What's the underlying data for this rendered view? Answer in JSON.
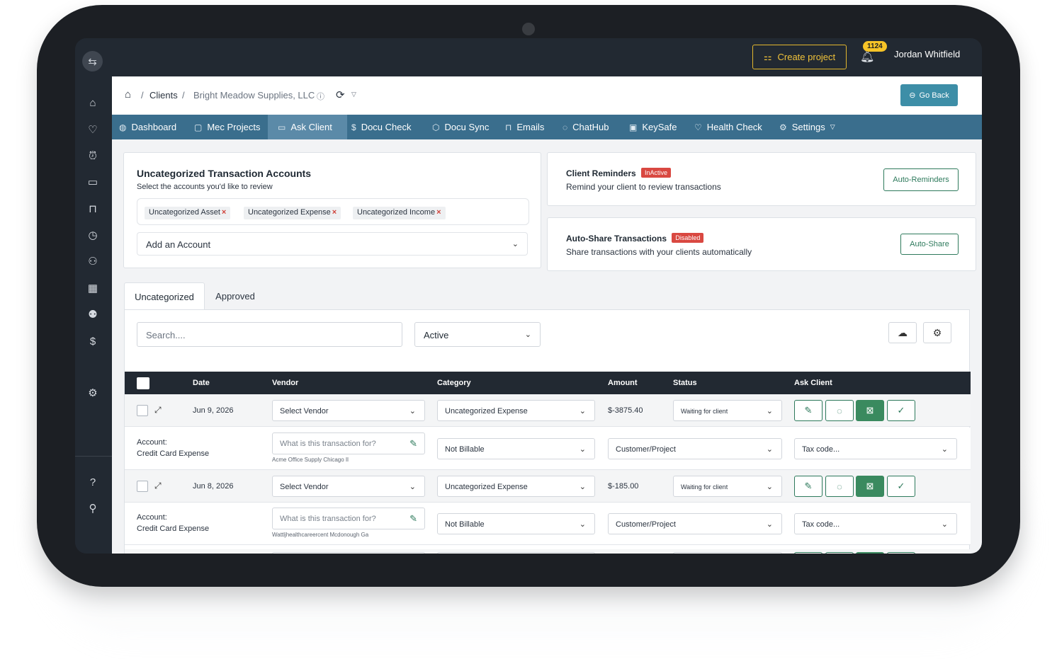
{
  "topbar": {
    "create_project": "Create project",
    "notifications": "1124",
    "user_name": "Jordan Whitfield"
  },
  "sidebar": {
    "icons": [
      "home-icon",
      "heart-icon",
      "alarm-icon",
      "briefcase-icon",
      "book-icon",
      "clock-icon",
      "users-icon",
      "calendar-icon",
      "team-icon",
      "dollar-icon",
      "gear-icon",
      "help-icon",
      "user-icon"
    ]
  },
  "breadcrumb": {
    "clients": "Clients",
    "client_name": "Bright Meadow Supplies, LLC",
    "go_back": "Go Back"
  },
  "nav": {
    "items": [
      {
        "label": "Dashboard",
        "icon": "palette-icon"
      },
      {
        "label": "Mec Projects",
        "icon": "folder-icon"
      },
      {
        "label": "Ask Client",
        "icon": "card-icon"
      },
      {
        "label": "Docu Check",
        "icon": "dollar-icon"
      },
      {
        "label": "Docu Sync",
        "icon": "box-icon"
      },
      {
        "label": "Emails",
        "icon": "book-icon"
      },
      {
        "label": "ChatHub",
        "icon": "chat-icon"
      },
      {
        "label": "KeySafe",
        "icon": "safe-icon"
      },
      {
        "label": "Health Check",
        "icon": "heart-icon"
      },
      {
        "label": "Settings",
        "icon": "gear-icon"
      }
    ],
    "active": "Ask Client"
  },
  "accounts_card": {
    "title": "Uncategorized Transaction Accounts",
    "subtitle": "Select the accounts you'd like to review",
    "chips": [
      "Uncategorized Asset",
      "Uncategorized Expense",
      "Uncategorized Income"
    ],
    "add_account": "Add an Account"
  },
  "reminders_card": {
    "title": "Client Reminders",
    "badge": "InActive",
    "subtitle": "Remind your client to review transactions",
    "button": "Auto-Reminders"
  },
  "autoshare_card": {
    "title": "Auto-Share Transactions",
    "badge": "Disabled",
    "subtitle": "Share transactions with your clients automatically",
    "button": "Auto-Share"
  },
  "tabs": {
    "uncategorized": "Uncategorized",
    "approved": "Approved"
  },
  "filters": {
    "search_placeholder": "Search....",
    "status": "Active"
  },
  "table": {
    "headers": {
      "date": "Date",
      "vendor": "Vendor",
      "category": "Category",
      "amount": "Amount",
      "status": "Status",
      "ask_client": "Ask Client"
    },
    "rows": [
      {
        "date": "Jun 9, 2026",
        "vendor": "Select Vendor",
        "category": "Uncategorized Expense",
        "amount": "$-3875.40",
        "status": "Waiting for client",
        "account_label": "Account:",
        "account": "Credit Card Expense",
        "memo_placeholder": "What is this transaction for?",
        "memo_note": "Acme Office Supply Chicago Il",
        "billable": "Not Billable",
        "customer": "Customer/Project",
        "tax": "Tax code..."
      },
      {
        "date": "Jun 8, 2026",
        "vendor": "Select Vendor",
        "category": "Uncategorized Expense",
        "amount": "$-185.00",
        "status": "Waiting for client",
        "account_label": "Account:",
        "account": "Credit Card Expense",
        "memo_placeholder": "What is this transaction for?",
        "memo_note": "Wattljhealthcareercent Mcdonough Ga",
        "billable": "Not Billable",
        "customer": "Customer/Project",
        "tax": "Tax code..."
      }
    ]
  },
  "colors": {
    "nav": "#3a6e8d",
    "accent_green": "#2e7a5c",
    "badge_red": "#d94841",
    "create_yellow": "#f0c23a"
  }
}
